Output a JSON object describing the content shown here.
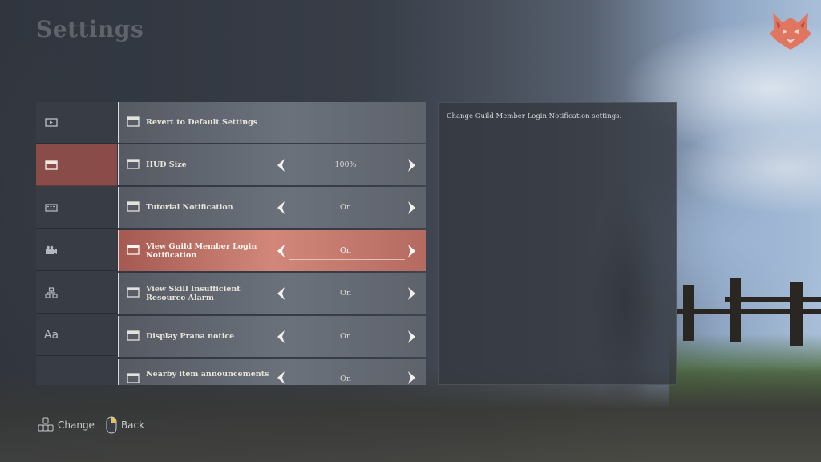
{
  "page": {
    "title": "Settings"
  },
  "emblem": {
    "icon": "fox-crest-icon",
    "color": "#e0765f"
  },
  "categories": [
    {
      "icon": "display-icon",
      "active": false
    },
    {
      "icon": "window-icon",
      "active": true
    },
    {
      "icon": "keyboard-icon",
      "active": false
    },
    {
      "icon": "camera-icon",
      "active": false
    },
    {
      "icon": "network-icon",
      "active": false
    },
    {
      "icon": "font-icon",
      "label": "Aa",
      "active": false
    }
  ],
  "settings": [
    {
      "label": "Revert to Default Settings",
      "value": null,
      "has_arrows": false,
      "active": false
    },
    {
      "label": "HUD Size",
      "value": "100%",
      "has_arrows": true,
      "active": false
    },
    {
      "label": "Tutorial Notification",
      "value": "On",
      "has_arrows": true,
      "active": false
    },
    {
      "label": "View Guild Member Login Notification",
      "value": "On",
      "has_arrows": true,
      "active": true
    },
    {
      "label": "View Skill Insufficient Resource Alarm",
      "value": "On",
      "has_arrows": true,
      "active": false
    },
    {
      "label": "Display Prana notice",
      "value": "On",
      "has_arrows": true,
      "active": false
    },
    {
      "label": "Nearby item announcements",
      "value": "On",
      "has_arrows": true,
      "active": false
    }
  ],
  "description": {
    "text": "Change Guild Member Login Notification settings."
  },
  "footer": {
    "change": {
      "label": "Change",
      "icon": "wasd-keys-icon"
    },
    "back": {
      "label": "Back",
      "icon": "mouse-right-button-icon"
    }
  },
  "colors": {
    "accent": "#c27568",
    "active_category": "#8a4c48",
    "title": "#5f646c"
  }
}
